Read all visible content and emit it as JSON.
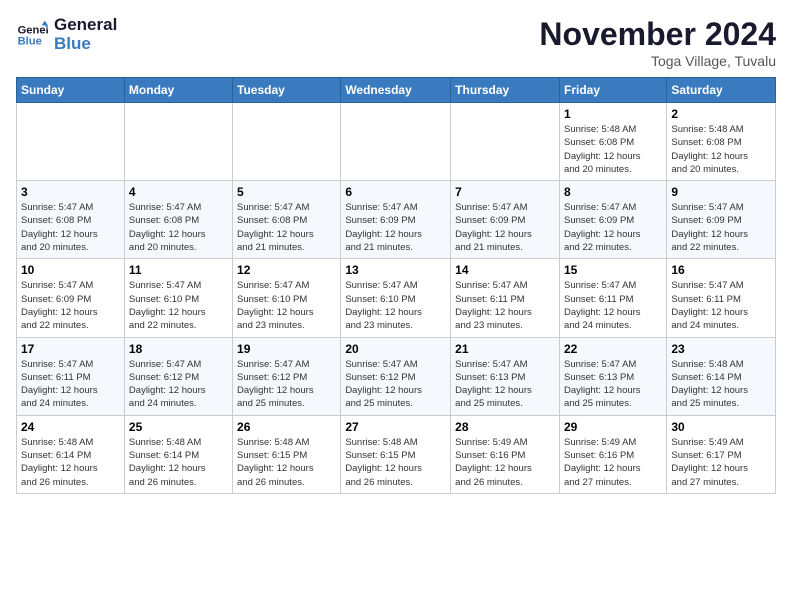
{
  "logo": {
    "line1": "General",
    "line2": "Blue"
  },
  "title": "November 2024",
  "subtitle": "Toga Village, Tuvalu",
  "days_of_week": [
    "Sunday",
    "Monday",
    "Tuesday",
    "Wednesday",
    "Thursday",
    "Friday",
    "Saturday"
  ],
  "weeks": [
    [
      {
        "day": "",
        "info": ""
      },
      {
        "day": "",
        "info": ""
      },
      {
        "day": "",
        "info": ""
      },
      {
        "day": "",
        "info": ""
      },
      {
        "day": "",
        "info": ""
      },
      {
        "day": "1",
        "info": "Sunrise: 5:48 AM\nSunset: 6:08 PM\nDaylight: 12 hours\nand 20 minutes."
      },
      {
        "day": "2",
        "info": "Sunrise: 5:48 AM\nSunset: 6:08 PM\nDaylight: 12 hours\nand 20 minutes."
      }
    ],
    [
      {
        "day": "3",
        "info": "Sunrise: 5:47 AM\nSunset: 6:08 PM\nDaylight: 12 hours\nand 20 minutes."
      },
      {
        "day": "4",
        "info": "Sunrise: 5:47 AM\nSunset: 6:08 PM\nDaylight: 12 hours\nand 20 minutes."
      },
      {
        "day": "5",
        "info": "Sunrise: 5:47 AM\nSunset: 6:08 PM\nDaylight: 12 hours\nand 21 minutes."
      },
      {
        "day": "6",
        "info": "Sunrise: 5:47 AM\nSunset: 6:09 PM\nDaylight: 12 hours\nand 21 minutes."
      },
      {
        "day": "7",
        "info": "Sunrise: 5:47 AM\nSunset: 6:09 PM\nDaylight: 12 hours\nand 21 minutes."
      },
      {
        "day": "8",
        "info": "Sunrise: 5:47 AM\nSunset: 6:09 PM\nDaylight: 12 hours\nand 22 minutes."
      },
      {
        "day": "9",
        "info": "Sunrise: 5:47 AM\nSunset: 6:09 PM\nDaylight: 12 hours\nand 22 minutes."
      }
    ],
    [
      {
        "day": "10",
        "info": "Sunrise: 5:47 AM\nSunset: 6:09 PM\nDaylight: 12 hours\nand 22 minutes."
      },
      {
        "day": "11",
        "info": "Sunrise: 5:47 AM\nSunset: 6:10 PM\nDaylight: 12 hours\nand 22 minutes."
      },
      {
        "day": "12",
        "info": "Sunrise: 5:47 AM\nSunset: 6:10 PM\nDaylight: 12 hours\nand 23 minutes."
      },
      {
        "day": "13",
        "info": "Sunrise: 5:47 AM\nSunset: 6:10 PM\nDaylight: 12 hours\nand 23 minutes."
      },
      {
        "day": "14",
        "info": "Sunrise: 5:47 AM\nSunset: 6:11 PM\nDaylight: 12 hours\nand 23 minutes."
      },
      {
        "day": "15",
        "info": "Sunrise: 5:47 AM\nSunset: 6:11 PM\nDaylight: 12 hours\nand 24 minutes."
      },
      {
        "day": "16",
        "info": "Sunrise: 5:47 AM\nSunset: 6:11 PM\nDaylight: 12 hours\nand 24 minutes."
      }
    ],
    [
      {
        "day": "17",
        "info": "Sunrise: 5:47 AM\nSunset: 6:11 PM\nDaylight: 12 hours\nand 24 minutes."
      },
      {
        "day": "18",
        "info": "Sunrise: 5:47 AM\nSunset: 6:12 PM\nDaylight: 12 hours\nand 24 minutes."
      },
      {
        "day": "19",
        "info": "Sunrise: 5:47 AM\nSunset: 6:12 PM\nDaylight: 12 hours\nand 25 minutes."
      },
      {
        "day": "20",
        "info": "Sunrise: 5:47 AM\nSunset: 6:12 PM\nDaylight: 12 hours\nand 25 minutes."
      },
      {
        "day": "21",
        "info": "Sunrise: 5:47 AM\nSunset: 6:13 PM\nDaylight: 12 hours\nand 25 minutes."
      },
      {
        "day": "22",
        "info": "Sunrise: 5:47 AM\nSunset: 6:13 PM\nDaylight: 12 hours\nand 25 minutes."
      },
      {
        "day": "23",
        "info": "Sunrise: 5:48 AM\nSunset: 6:14 PM\nDaylight: 12 hours\nand 25 minutes."
      }
    ],
    [
      {
        "day": "24",
        "info": "Sunrise: 5:48 AM\nSunset: 6:14 PM\nDaylight: 12 hours\nand 26 minutes."
      },
      {
        "day": "25",
        "info": "Sunrise: 5:48 AM\nSunset: 6:14 PM\nDaylight: 12 hours\nand 26 minutes."
      },
      {
        "day": "26",
        "info": "Sunrise: 5:48 AM\nSunset: 6:15 PM\nDaylight: 12 hours\nand 26 minutes."
      },
      {
        "day": "27",
        "info": "Sunrise: 5:48 AM\nSunset: 6:15 PM\nDaylight: 12 hours\nand 26 minutes."
      },
      {
        "day": "28",
        "info": "Sunrise: 5:49 AM\nSunset: 6:16 PM\nDaylight: 12 hours\nand 26 minutes."
      },
      {
        "day": "29",
        "info": "Sunrise: 5:49 AM\nSunset: 6:16 PM\nDaylight: 12 hours\nand 27 minutes."
      },
      {
        "day": "30",
        "info": "Sunrise: 5:49 AM\nSunset: 6:17 PM\nDaylight: 12 hours\nand 27 minutes."
      }
    ]
  ]
}
